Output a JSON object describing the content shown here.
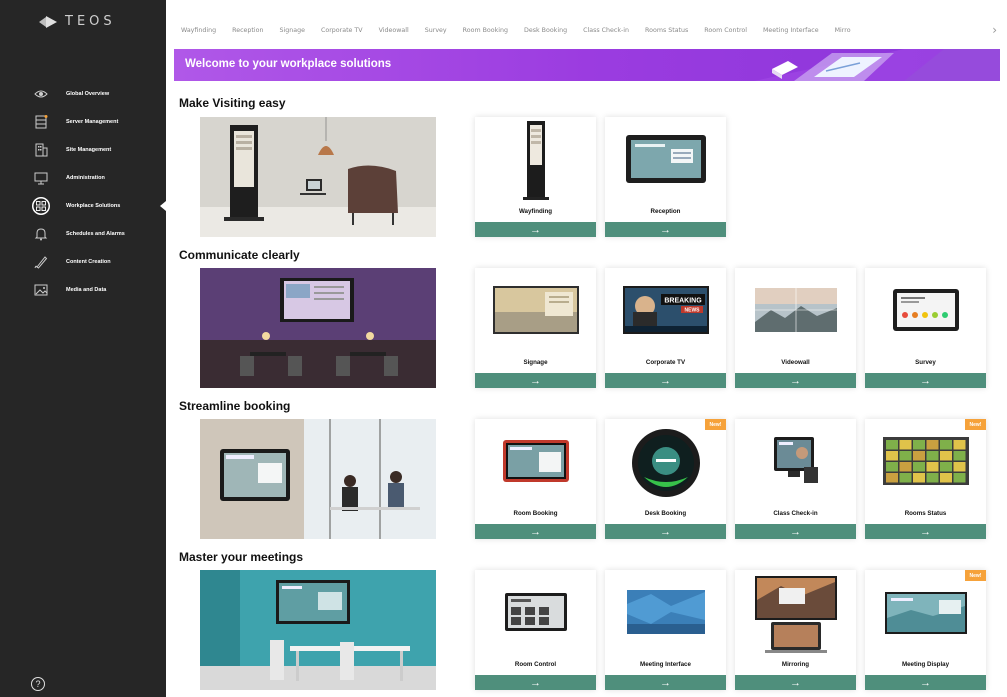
{
  "app": {
    "logo_text": "TEOS"
  },
  "sidebar": {
    "items": [
      {
        "label": "Global Overview",
        "icon": "eye-icon"
      },
      {
        "label": "Server Management",
        "icon": "server-icon"
      },
      {
        "label": "Site Management",
        "icon": "building-icon"
      },
      {
        "label": "Administration",
        "icon": "monitor-icon"
      },
      {
        "label": "Workplace Solutions",
        "icon": "grid-circle-icon",
        "active": true
      },
      {
        "label": "Schedules and Alarms",
        "icon": "bell-icon"
      },
      {
        "label": "Content Creation",
        "icon": "pen-icon"
      },
      {
        "label": "Media and Data",
        "icon": "image-icon"
      }
    ],
    "help_label": "?"
  },
  "tabs": [
    "Wayfinding",
    "Reception",
    "Signage",
    "Corporate TV",
    "Videowall",
    "Survey",
    "Room Booking",
    "Desk Booking",
    "Class Check-in",
    "Rooms Status",
    "Room Control",
    "Meeting Interface",
    "Mirro"
  ],
  "tabs_more": "›",
  "banner": {
    "title": "Welcome to your workplace solutions"
  },
  "sections": [
    {
      "title": "Make Visiting easy",
      "cards": [
        {
          "label": "Wayfinding"
        },
        {
          "label": "Reception"
        }
      ]
    },
    {
      "title": "Communicate clearly",
      "cards": [
        {
          "label": "Signage"
        },
        {
          "label": "Corporate TV"
        },
        {
          "label": "Videowall"
        },
        {
          "label": "Survey"
        }
      ]
    },
    {
      "title": "Streamline booking",
      "cards": [
        {
          "label": "Room Booking"
        },
        {
          "label": "Desk Booking",
          "badge": "New!"
        },
        {
          "label": "Class Check-in"
        },
        {
          "label": "Rooms Status",
          "badge": "New!"
        }
      ]
    },
    {
      "title": "Master your meetings",
      "cards": [
        {
          "label": "Room Control"
        },
        {
          "label": "Meeting Interface"
        },
        {
          "label": "Mirroring"
        },
        {
          "label": "Meeting Display",
          "badge": "New!"
        }
      ]
    }
  ],
  "thumb_texts": {
    "breaking": "BREAKING",
    "news": "NEWS"
  },
  "card_action": "→",
  "colors": {
    "sidebar": "#262626",
    "banner": "#9b3ce0",
    "action": "#4f8f7c",
    "badge": "#f6a23a"
  }
}
